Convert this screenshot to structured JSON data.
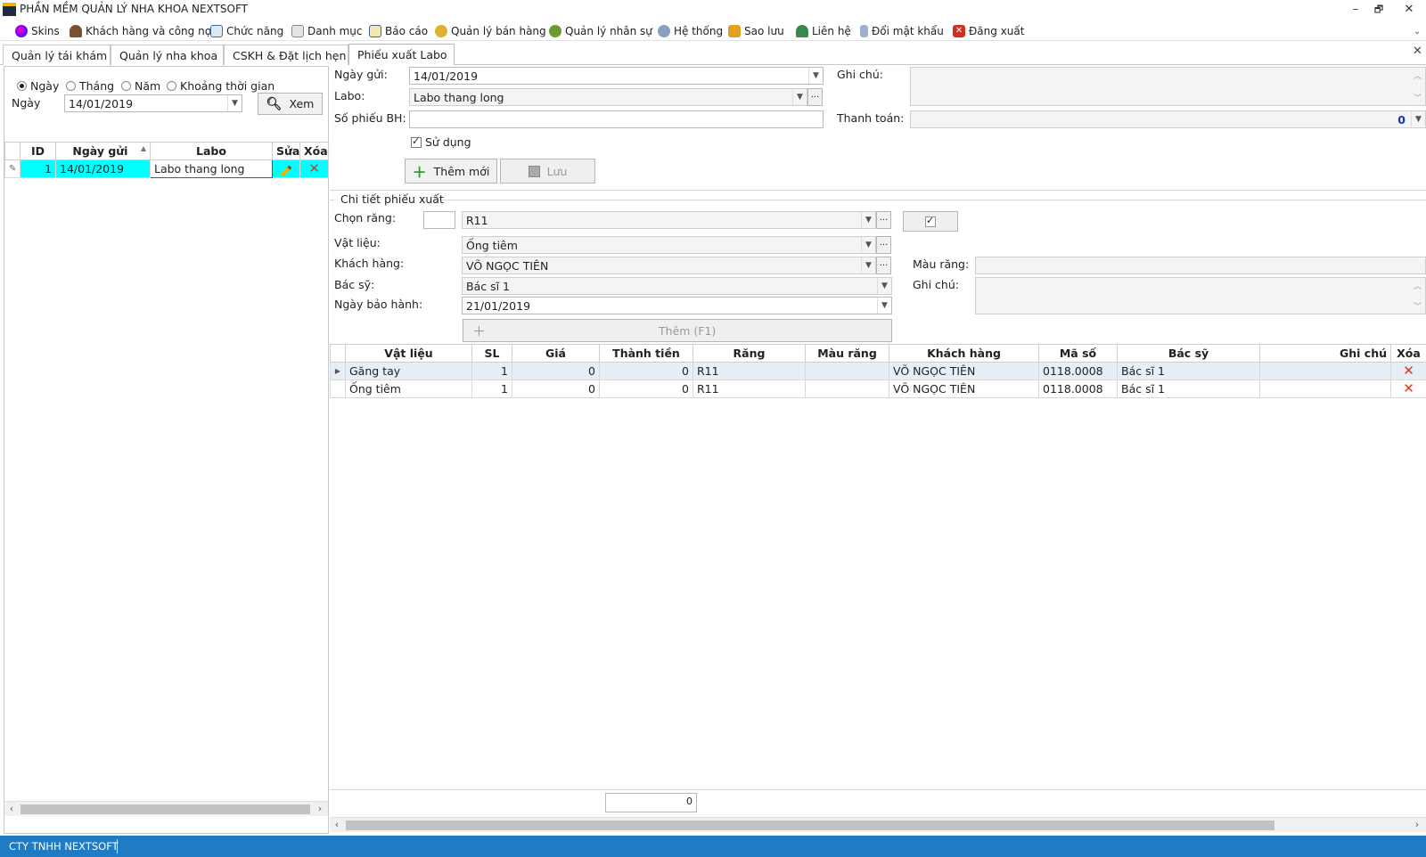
{
  "window": {
    "title": "PHẦN MỀM QUẢN LÝ NHA KHOA NEXTSOFT",
    "minimize": "–",
    "restore": "🗗",
    "close": "✕"
  },
  "menu": [
    {
      "label": "Skins",
      "icon": "skins-icon",
      "color": "#c04ad0"
    },
    {
      "label": "Khách hàng và công nợ",
      "icon": "customer-icon",
      "color": "#7a5030"
    },
    {
      "label": "Chức năng",
      "icon": "function-icon",
      "color": "#3a6fb0"
    },
    {
      "label": "Danh mục",
      "icon": "catalog-icon",
      "color": "#808080"
    },
    {
      "label": "Báo cáo",
      "icon": "report-icon",
      "color": "#4060a0"
    },
    {
      "label": "Quản lý bán hàng",
      "icon": "sales-icon",
      "color": "#d0a020"
    },
    {
      "label": "Quản lý nhân sự",
      "icon": "staff-icon",
      "color": "#6a9a30"
    },
    {
      "label": "Hệ thống",
      "icon": "system-icon",
      "color": "#5070a0"
    },
    {
      "label": "Sao lưu",
      "icon": "backup-icon",
      "color": "#e0a020"
    },
    {
      "label": "Liên hệ",
      "icon": "contact-icon",
      "color": "#3a8a50"
    },
    {
      "label": "Đổi mật khẩu",
      "icon": "password-icon",
      "color": "#5a7ab0"
    },
    {
      "label": "Đăng xuất",
      "icon": "logout-icon",
      "color": "#d03020"
    }
  ],
  "tabs": [
    "Quản lý tái khám",
    "Quản lý nha khoa",
    "CSKH & Đặt lịch hẹn",
    "Phiếu xuất Labo"
  ],
  "active_tab": "Phiếu xuất Labo",
  "filter": {
    "radios": [
      {
        "label": "Ngày",
        "checked": true
      },
      {
        "label": "Tháng",
        "checked": false
      },
      {
        "label": "Năm",
        "checked": false
      },
      {
        "label": "Khoảng thời gian",
        "checked": false
      }
    ],
    "date_label": "Ngày",
    "date_value": "14/01/2019",
    "view_button": "Xem"
  },
  "left_grid": {
    "headers": [
      "ID",
      "Ngày gửi",
      "Labo",
      "Sửa",
      "Xóa"
    ],
    "rows": [
      {
        "id": "1",
        "date": "14/01/2019",
        "labo": "Labo thang long"
      }
    ]
  },
  "form": {
    "send_date_label": "Ngày gửi:",
    "send_date": "14/01/2019",
    "labo_label": "Labo:",
    "labo": "Labo thang long",
    "warranty_no_label": "Số phiếu BH:",
    "warranty_no": "",
    "note_label": "Ghi chú:",
    "note": "",
    "payment_label": "Thanh toán:",
    "payment": "0",
    "use_label": "Sử dụng",
    "use_checked": true,
    "add_new_button": "Thêm mới",
    "save_button": "Lưu"
  },
  "detail": {
    "group_title": "Chi tiết phiếu xuất",
    "tooth_label": "Chọn răng:",
    "tooth_code": "",
    "tooth": "R11",
    "material_label": "Vật liệu:",
    "material": "Ống tiêm",
    "customer_label": "Khách hàng:",
    "customer": "VÕ NGỌC TIÊN",
    "tooth_color_label": "Màu răng:",
    "tooth_color": "",
    "doctor_label": "Bác sỹ:",
    "doctor": "Bác sĩ 1",
    "detail_note_label": "Ghi chú:",
    "detail_note": "",
    "warranty_date_label": "Ngày bảo hành:",
    "warranty_date": "21/01/2019",
    "add_button": "Thêm (F1)",
    "ellipsis": "···"
  },
  "detail_grid": {
    "headers": [
      "Vật liệu",
      "SL",
      "Giá",
      "Thành tiền",
      "Răng",
      "Màu răng",
      "Khách hàng",
      "Mã số",
      "Bác sỹ",
      "Ghi chú",
      "Xóa"
    ],
    "rows": [
      {
        "material": "Găng tay",
        "qty": "1",
        "price": "0",
        "total": "0",
        "tooth": "R11",
        "color": "",
        "customer": "VÕ NGỌC TIÊN",
        "code": "0118.0008",
        "doctor": "Bác sĩ 1",
        "note": ""
      },
      {
        "material": "Ống tiêm",
        "qty": "1",
        "price": "0",
        "total": "0",
        "tooth": "R11",
        "color": "",
        "customer": "VÕ NGỌC TIÊN",
        "code": "0118.0008",
        "doctor": "Bác sĩ 1",
        "note": ""
      }
    ],
    "sum_total": "0"
  },
  "status": {
    "company": "CTY TNHH NEXTSOFT"
  },
  "colors": {
    "status_bar": "#1f7bc4",
    "selected_row": "#00ffff",
    "delete_icon": "#e03a1e",
    "edit_icon": "#e8b400"
  }
}
